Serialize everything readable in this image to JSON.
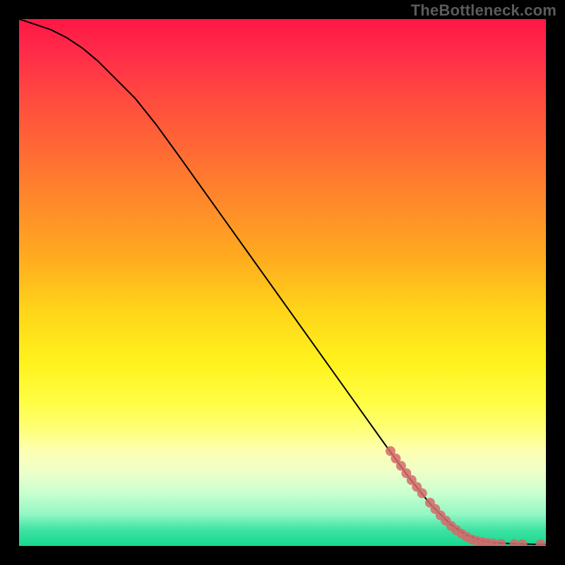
{
  "watermark": "TheBottleneck.com",
  "chart_data": {
    "type": "line",
    "title": "",
    "xlabel": "",
    "ylabel": "",
    "xlim": [
      0,
      100
    ],
    "ylim": [
      0,
      100
    ],
    "series": [
      {
        "name": "curve",
        "x": [
          0,
          3,
          6,
          9,
          12,
          15,
          18,
          22,
          26,
          30,
          35,
          40,
          45,
          50,
          55,
          60,
          65,
          70,
          74,
          78,
          82,
          85,
          88,
          90,
          92,
          94,
          96,
          98,
          100
        ],
        "y": [
          100,
          99,
          98,
          96.5,
          94.5,
          92,
          89,
          85,
          80,
          74.5,
          67.5,
          60.5,
          53.5,
          46.5,
          39.5,
          32.5,
          25.5,
          18.5,
          13,
          8,
          4,
          2,
          1,
          0.6,
          0.5,
          0.4,
          0.35,
          0.3,
          0.3
        ]
      }
    ],
    "markers": [
      {
        "x": 70.5,
        "y": 18.0
      },
      {
        "x": 71.5,
        "y": 16.6
      },
      {
        "x": 72.5,
        "y": 15.2
      },
      {
        "x": 73.5,
        "y": 13.8
      },
      {
        "x": 74.5,
        "y": 12.5
      },
      {
        "x": 75.5,
        "y": 11.2
      },
      {
        "x": 76.5,
        "y": 10.0
      },
      {
        "x": 78.0,
        "y": 8.2
      },
      {
        "x": 79.0,
        "y": 7.0
      },
      {
        "x": 80.0,
        "y": 5.8
      },
      {
        "x": 81.0,
        "y": 4.8
      },
      {
        "x": 82.0,
        "y": 3.8
      },
      {
        "x": 83.0,
        "y": 3.0
      },
      {
        "x": 84.0,
        "y": 2.3
      },
      {
        "x": 85.0,
        "y": 1.7
      },
      {
        "x": 86.0,
        "y": 1.2
      },
      {
        "x": 87.0,
        "y": 0.9
      },
      {
        "x": 88.0,
        "y": 0.7
      },
      {
        "x": 89.0,
        "y": 0.55
      },
      {
        "x": 90.0,
        "y": 0.45
      },
      {
        "x": 91.5,
        "y": 0.4
      },
      {
        "x": 94.0,
        "y": 0.35
      },
      {
        "x": 95.5,
        "y": 0.33
      },
      {
        "x": 99.0,
        "y": 0.3
      }
    ],
    "marker_color": "#d46a6a",
    "curve_color": "#000000"
  }
}
